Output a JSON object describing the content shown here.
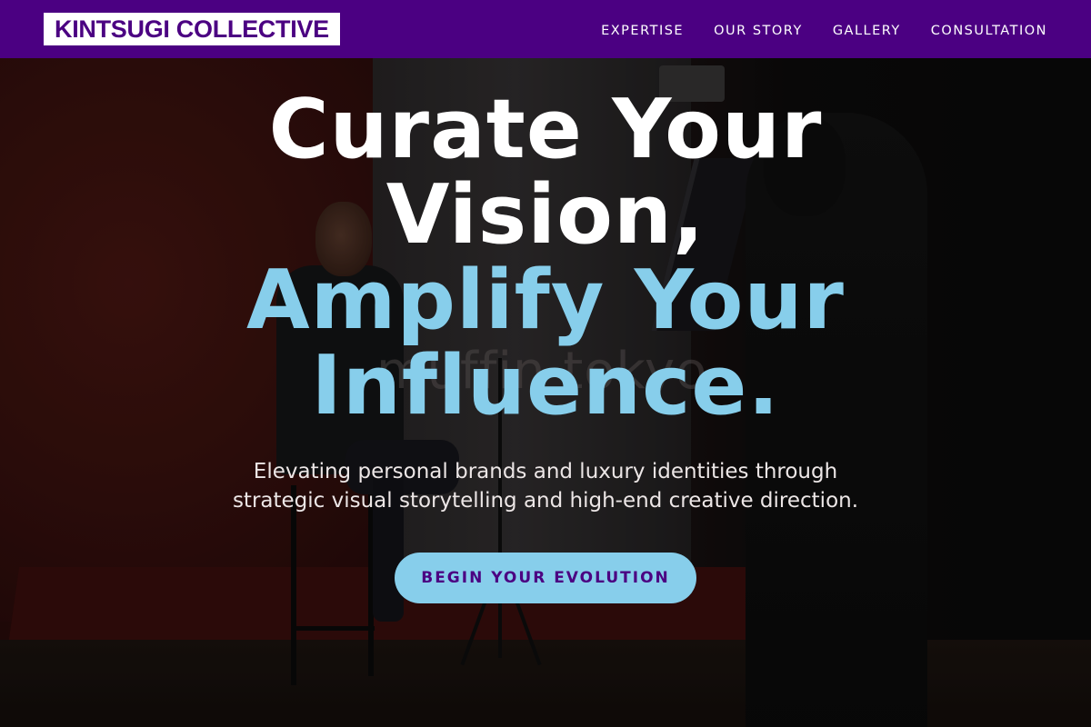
{
  "brand": {
    "logo_text": "KINTSUGI COLLECTIVE"
  },
  "nav": {
    "items": [
      {
        "label": "EXPERTISE"
      },
      {
        "label": "OUR STORY"
      },
      {
        "label": "GALLERY"
      },
      {
        "label": "CONSULTATION"
      }
    ]
  },
  "hero": {
    "headline_line1": "Curate Your",
    "headline_line2": "Vision,",
    "headline_accent_line1": "Amplify Your",
    "headline_accent_line2": "Influence.",
    "subtitle": "Elevating personal brands and luxury identities through strategic visual storytelling and high-end creative direction.",
    "cta_label": "BEGIN YOUR EVOLUTION",
    "background_watermark": "muffin tokyo"
  },
  "colors": {
    "nav_background": "#4b0082",
    "accent": "#87ceeb",
    "text": "#ffffff"
  }
}
